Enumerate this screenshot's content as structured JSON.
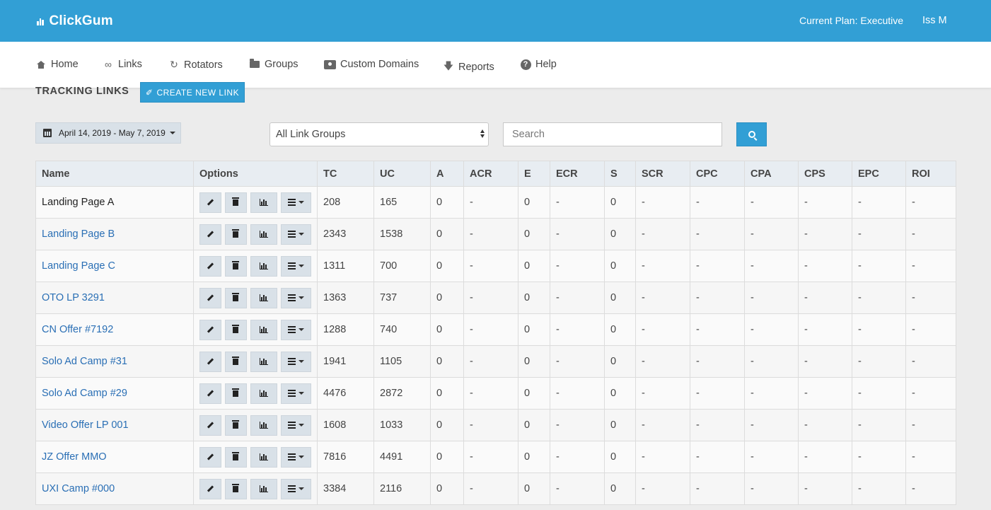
{
  "app": {
    "brand": "ClickGum",
    "plan_label": "Current Plan: Executive",
    "user": "Iss M",
    "accent_color": "#329fd5"
  },
  "nav": {
    "items": [
      {
        "label": "Home",
        "icon": "home-icon"
      },
      {
        "label": "Links",
        "icon": "link-icon"
      },
      {
        "label": "Rotators",
        "icon": "refresh-icon"
      },
      {
        "label": "Groups",
        "icon": "folder-icon"
      },
      {
        "label": "Custom Domains",
        "icon": "domain-icon"
      },
      {
        "label": "Reports",
        "icon": "download-icon"
      },
      {
        "label": "Help",
        "icon": "help-icon"
      }
    ]
  },
  "page": {
    "title": "TRACKING LINKS",
    "create_label": "CREATE NEW LINK"
  },
  "filters": {
    "date_range": "April 14, 2019 - May 7, 2019",
    "group_select": "All Link Groups",
    "search_placeholder": "Search"
  },
  "table": {
    "columns": [
      "Name",
      "Options",
      "TC",
      "UC",
      "A",
      "ACR",
      "E",
      "ECR",
      "S",
      "SCR",
      "CPC",
      "CPA",
      "CPS",
      "EPC",
      "ROI"
    ],
    "rows": [
      {
        "name": "Landing Page A",
        "tc": "208",
        "uc": "165",
        "a": "0",
        "acr": "-",
        "e": "0",
        "ecr": "-",
        "s": "0",
        "scr": "-",
        "cpc": "-",
        "cpa": "-",
        "cps": "-",
        "epc": "-",
        "roi": "-"
      },
      {
        "name": "Landing Page B",
        "tc": "2343",
        "uc": "1538",
        "a": "0",
        "acr": "-",
        "e": "0",
        "ecr": "-",
        "s": "0",
        "scr": "-",
        "cpc": "-",
        "cpa": "-",
        "cps": "-",
        "epc": "-",
        "roi": "-"
      },
      {
        "name": "Landing Page C",
        "tc": "1311",
        "uc": "700",
        "a": "0",
        "acr": "-",
        "e": "0",
        "ecr": "-",
        "s": "0",
        "scr": "-",
        "cpc": "-",
        "cpa": "-",
        "cps": "-",
        "epc": "-",
        "roi": "-"
      },
      {
        "name": "OTO LP 3291",
        "tc": "1363",
        "uc": "737",
        "a": "0",
        "acr": "-",
        "e": "0",
        "ecr": "-",
        "s": "0",
        "scr": "-",
        "cpc": "-",
        "cpa": "-",
        "cps": "-",
        "epc": "-",
        "roi": "-"
      },
      {
        "name": "CN Offer #7192",
        "tc": "1288",
        "uc": "740",
        "a": "0",
        "acr": "-",
        "e": "0",
        "ecr": "-",
        "s": "0",
        "scr": "-",
        "cpc": "-",
        "cpa": "-",
        "cps": "-",
        "epc": "-",
        "roi": "-"
      },
      {
        "name": "Solo Ad Camp #31",
        "tc": "1941",
        "uc": "1105",
        "a": "0",
        "acr": "-",
        "e": "0",
        "ecr": "-",
        "s": "0",
        "scr": "-",
        "cpc": "-",
        "cpa": "-",
        "cps": "-",
        "epc": "-",
        "roi": "-"
      },
      {
        "name": "Solo Ad Camp #29",
        "tc": "4476",
        "uc": "2872",
        "a": "0",
        "acr": "-",
        "e": "0",
        "ecr": "-",
        "s": "0",
        "scr": "-",
        "cpc": "-",
        "cpa": "-",
        "cps": "-",
        "epc": "-",
        "roi": "-"
      },
      {
        "name": "Video Offer LP 001",
        "tc": "1608",
        "uc": "1033",
        "a": "0",
        "acr": "-",
        "e": "0",
        "ecr": "-",
        "s": "0",
        "scr": "-",
        "cpc": "-",
        "cpa": "-",
        "cps": "-",
        "epc": "-",
        "roi": "-"
      },
      {
        "name": "JZ Offer MMO",
        "tc": "7816",
        "uc": "4491",
        "a": "0",
        "acr": "-",
        "e": "0",
        "ecr": "-",
        "s": "0",
        "scr": "-",
        "cpc": "-",
        "cpa": "-",
        "cps": "-",
        "epc": "-",
        "roi": "-"
      },
      {
        "name": "UXI Camp #000",
        "tc": "3384",
        "uc": "2116",
        "a": "0",
        "acr": "-",
        "e": "0",
        "ecr": "-",
        "s": "0",
        "scr": "-",
        "cpc": "-",
        "cpa": "-",
        "cps": "-",
        "epc": "-",
        "roi": "-"
      }
    ]
  }
}
